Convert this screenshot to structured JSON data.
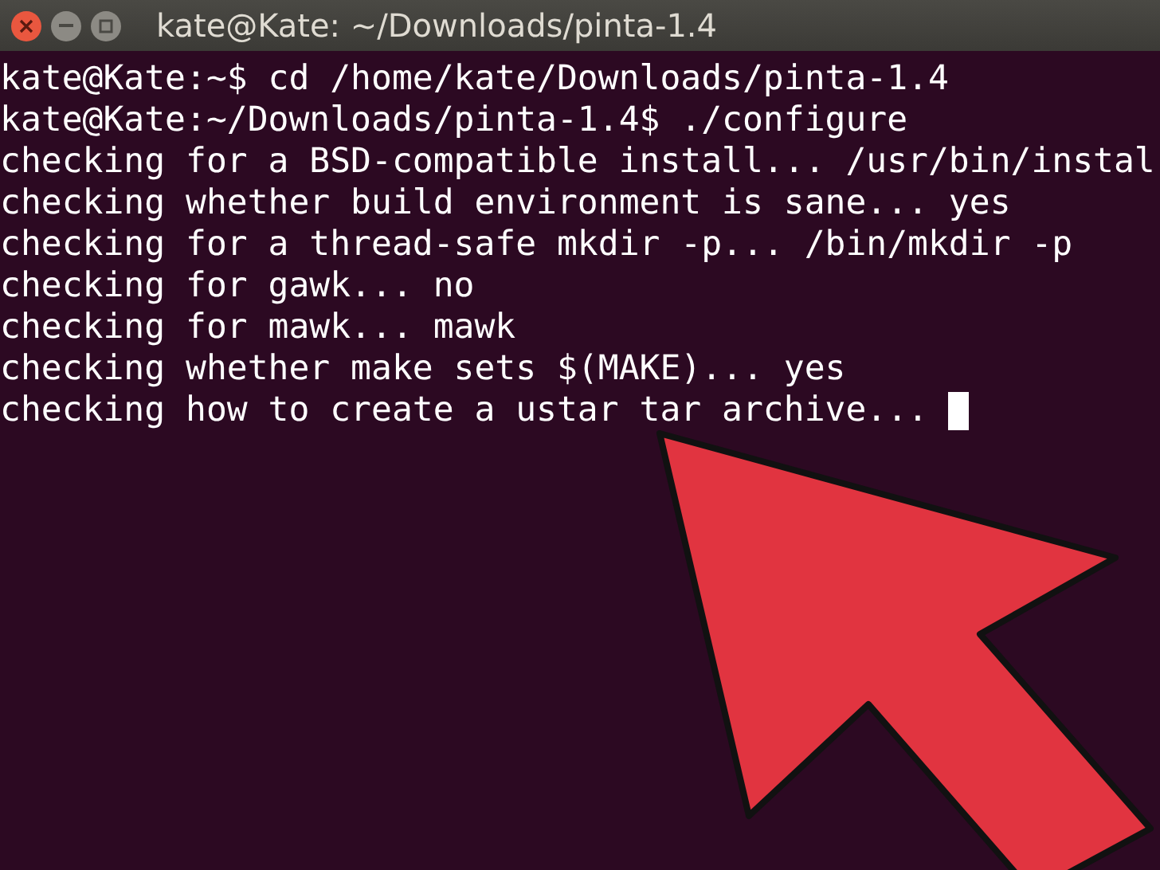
{
  "window": {
    "title": "kate@Kate: ~/Downloads/pinta-1.4"
  },
  "terminal": {
    "lines": [
      "kate@Kate:~$ cd /home/kate/Downloads/pinta-1.4",
      "kate@Kate:~/Downloads/pinta-1.4$ ./configure",
      "checking for a BSD-compatible install... /usr/bin/instal",
      "checking whether build environment is sane... yes",
      "checking for a thread-safe mkdir -p... /bin/mkdir -p",
      "checking for gawk... no",
      "checking for mawk... mawk",
      "checking whether make sets $(MAKE)... yes",
      "checking how to create a ustar tar archive..."
    ]
  }
}
